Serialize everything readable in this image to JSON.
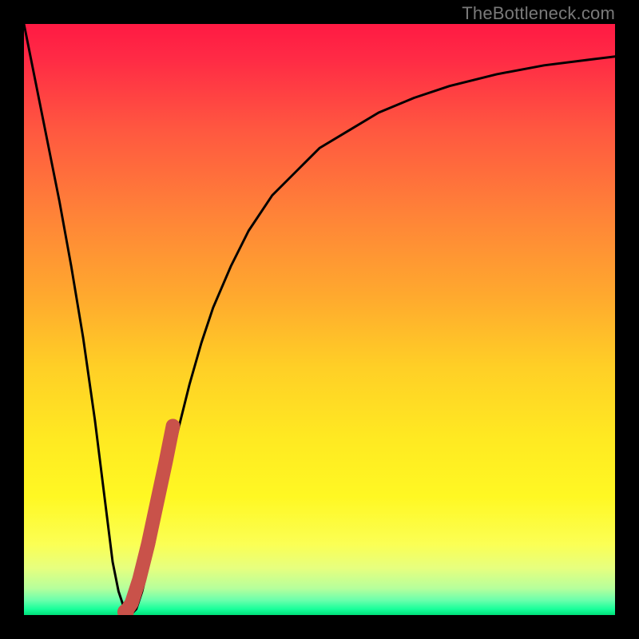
{
  "watermark": "TheBottleneck.com",
  "colors": {
    "frame": "#000000",
    "curve": "#000000",
    "marker_stroke": "#c9524a",
    "marker_fill": "#c9524a",
    "gradient_stops": [
      {
        "offset": 0.0,
        "color": "#ff1a44"
      },
      {
        "offset": 0.06,
        "color": "#ff2b45"
      },
      {
        "offset": 0.18,
        "color": "#ff5840"
      },
      {
        "offset": 0.32,
        "color": "#ff8238"
      },
      {
        "offset": 0.46,
        "color": "#ffa92e"
      },
      {
        "offset": 0.58,
        "color": "#ffcf26"
      },
      {
        "offset": 0.7,
        "color": "#ffe922"
      },
      {
        "offset": 0.8,
        "color": "#fff823"
      },
      {
        "offset": 0.88,
        "color": "#fbff54"
      },
      {
        "offset": 0.92,
        "color": "#e7ff7e"
      },
      {
        "offset": 0.955,
        "color": "#b6ff9c"
      },
      {
        "offset": 0.975,
        "color": "#6affac"
      },
      {
        "offset": 0.99,
        "color": "#18ff9a"
      },
      {
        "offset": 1.0,
        "color": "#00e07a"
      }
    ]
  },
  "chart_data": {
    "type": "line",
    "title": "",
    "xlabel": "",
    "ylabel": "",
    "xlim": [
      0,
      100
    ],
    "ylim": [
      0,
      100
    ],
    "series": [
      {
        "name": "bottleneck-curve",
        "x": [
          0,
          2,
          4,
          6,
          8,
          10,
          11,
          12,
          13,
          14,
          15,
          16,
          17,
          18,
          19,
          20,
          22,
          24,
          26,
          28,
          30,
          32,
          35,
          38,
          42,
          46,
          50,
          55,
          60,
          66,
          72,
          80,
          88,
          96,
          100
        ],
        "y": [
          100,
          90,
          80,
          70,
          59,
          47,
          40,
          33,
          25,
          17,
          9,
          4,
          1,
          0,
          1,
          4,
          12,
          22,
          31,
          39,
          46,
          52,
          59,
          65,
          71,
          75,
          79,
          82,
          85,
          87.5,
          89.5,
          91.5,
          93,
          94,
          94.5
        ]
      }
    ],
    "markers": {
      "name": "highlight-segment",
      "type": "line-with-endpoint",
      "x": [
        17.2,
        18.2,
        19.5,
        21.0,
        22.5,
        24.0,
        25.2
      ],
      "y": [
        0.5,
        2.0,
        6.0,
        12.0,
        19.0,
        26.0,
        32.0
      ],
      "endpoint": {
        "x": 17.2,
        "y": 0.5,
        "r": 1.4
      }
    }
  }
}
